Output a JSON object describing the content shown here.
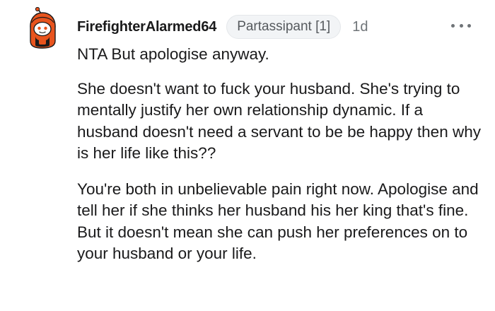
{
  "comment": {
    "username": "FirefighterAlarmed64",
    "flair": "Partassipant [1]",
    "age": "1d",
    "paragraphs": [
      "NTA But apologise anyway.",
      "She doesn't want to fuck your husband. She's trying to mentally justify her own relationship dynamic. If a husband doesn't need a servant to be be happy then why is her life like this??",
      "You're both in unbelievable pain right now. Apologise and tell her if she thinks her husband his her king that's fine. But it doesn't mean she can push her preferences on to your husband or your life."
    ]
  },
  "icons": {
    "avatar": "snoo-firefighter-avatar",
    "more": "more-options-icon"
  },
  "colors": {
    "text": "#1a1a1b",
    "meta": "#6f7478",
    "flair_bg": "#f2f4f6",
    "avatar_orange": "#e8541e"
  }
}
